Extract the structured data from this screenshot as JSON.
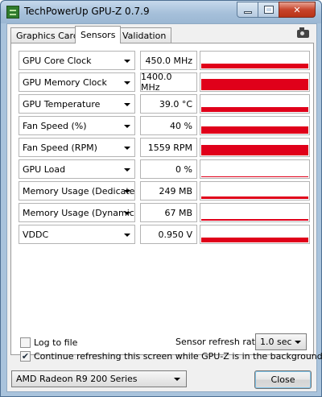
{
  "window": {
    "title": "TechPowerUp GPU-Z 0.7.9"
  },
  "tabs": [
    {
      "label": "Graphics Card"
    },
    {
      "label": "Sensors"
    },
    {
      "label": "Validation"
    }
  ],
  "sensors": [
    {
      "label": "GPU Core Clock",
      "value": "450.0 MHz",
      "level": 0.3
    },
    {
      "label": "GPU Memory Clock",
      "value": "1400.0 MHz",
      "level": 0.65
    },
    {
      "label": "GPU Temperature",
      "value": "39.0 °C",
      "level": 0.3
    },
    {
      "label": "Fan Speed (%)",
      "value": "40 %",
      "level": 0.45
    },
    {
      "label": "Fan Speed (RPM)",
      "value": "1559 RPM",
      "level": 0.6
    },
    {
      "label": "GPU Load",
      "value": "0 %",
      "level": 0
    },
    {
      "label": "Memory Usage (Dedicated)",
      "value": "249 MB",
      "level": 0.15
    },
    {
      "label": "Memory Usage (Dynamic)",
      "value": "67 MB",
      "level": 0.08
    },
    {
      "label": "VDDC",
      "value": "0.950 V",
      "level": 0.3
    }
  ],
  "options": {
    "log_to_file": "Log to file",
    "log_to_file_checked": false,
    "continue_refresh": "Continue refreshing this screen while GPU-Z is in the background",
    "continue_refresh_checked": true,
    "refresh_rate_label": "Sensor refresh rate:",
    "refresh_rate_value": "1.0 sec"
  },
  "footer": {
    "gpu_selected": "AMD Radeon R9 200 Series",
    "close_label": "Close"
  },
  "colors": {
    "graph": "#e0001a",
    "titlebar": "#a9c3dc"
  }
}
